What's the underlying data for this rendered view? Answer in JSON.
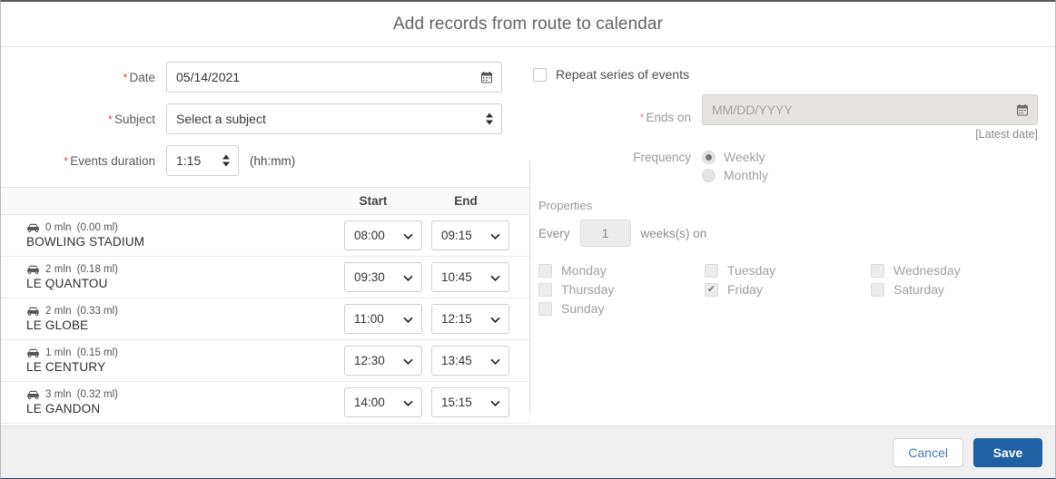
{
  "header": {
    "title": "Add records from route to calendar"
  },
  "left_form": {
    "date": {
      "label": "Date",
      "required": true,
      "value": "05/14/2021",
      "icon": "calendar-icon"
    },
    "subject": {
      "label": "Subject",
      "required": true,
      "value": "Select a subject",
      "icon": "spinner-up-down-icon"
    },
    "events_duration": {
      "label": "Events duration",
      "required": true,
      "value": "1:15",
      "hint": "(hh:mm)",
      "icon": "spinner-up-down-icon"
    }
  },
  "route_table": {
    "columns": [
      "",
      "Start",
      "End"
    ],
    "rows": [
      {
        "icon": "car-icon",
        "duration": "0 mln",
        "distance": "(0.00 ml)",
        "name": "BOWLING STADIUM",
        "start": "08:00",
        "end": "09:15"
      },
      {
        "icon": "car-icon",
        "duration": "2 mln",
        "distance": "(0.18 ml)",
        "name": "LE QUANTOU",
        "start": "09:30",
        "end": "10:45"
      },
      {
        "icon": "car-icon",
        "duration": "2 mln",
        "distance": "(0.33 ml)",
        "name": "LE GLOBE",
        "start": "11:00",
        "end": "12:15"
      },
      {
        "icon": "car-icon",
        "duration": "1 mln",
        "distance": "(0.15 ml)",
        "name": "LE CENTURY",
        "start": "12:30",
        "end": "13:45"
      },
      {
        "icon": "car-icon",
        "duration": "3 mln",
        "distance": "(0.32 ml)",
        "name": "LE GANDON",
        "start": "14:00",
        "end": "15:15"
      }
    ]
  },
  "right_form": {
    "repeat_series": {
      "label": "Repeat series of events",
      "checked": false
    },
    "ends_on": {
      "label": "Ends on",
      "required": true,
      "placeholder": "MM/DD/YYYY",
      "value": "",
      "hint": "[Latest date]",
      "icon": "calendar-icon",
      "disabled": true
    },
    "frequency": {
      "label": "Frequency",
      "selected": "Weekly",
      "options": [
        "Weekly",
        "Monthly"
      ]
    },
    "properties": {
      "title": "Properties",
      "every_prefix": "Every",
      "every_value": "1",
      "every_suffix": "weeks(s) on",
      "days": [
        {
          "label": "Monday",
          "checked": false
        },
        {
          "label": "Tuesday",
          "checked": false
        },
        {
          "label": "Wednesday",
          "checked": false
        },
        {
          "label": "Thursday",
          "checked": false
        },
        {
          "label": "Friday",
          "checked": true
        },
        {
          "label": "Saturday",
          "checked": false
        },
        {
          "label": "Sunday",
          "checked": false
        }
      ],
      "check_glyph": "✔"
    }
  },
  "footer": {
    "cancel_label": "Cancel",
    "save_label": "Save"
  },
  "colors": {
    "save_bg": "#1f5fa3",
    "cancel_text": "#4b77ab",
    "required_asterisk": "#d9534f",
    "footer_bg": "#f0f0f0"
  }
}
